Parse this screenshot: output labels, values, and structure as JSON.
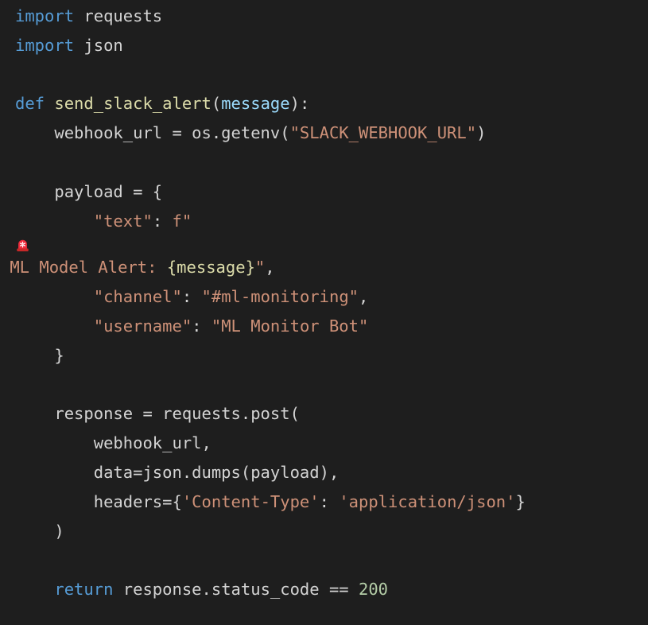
{
  "colors": {
    "background": "#1e1e1e",
    "keyword": "#569cd6",
    "function": "#dcdcaa",
    "parameter": "#9cdcfe",
    "string": "#ce9178",
    "number": "#b5cea8",
    "text": "#d4d4d4"
  },
  "code": {
    "l1": {
      "kw": "import",
      "rest": " requests"
    },
    "l2": {
      "kw": "import",
      "rest": " json"
    },
    "l4": {
      "kw": "def",
      "sp": " ",
      "fn": "send_slack_alert",
      "open": "(",
      "param": "message",
      "close": "):"
    },
    "l5": {
      "pre": "    webhook_url = os.getenv(",
      "str": "\"SLACK_WEBHOOK_URL\"",
      "post": ")"
    },
    "l7": {
      "text": "    payload = {"
    },
    "l8": {
      "indent": "        ",
      "key": "\"text\"",
      "colon": ": ",
      "fstr": "f\""
    },
    "l9_icon": "siren-emoji",
    "l10": {
      "str1": " ML Model Alert: ",
      "fmt": "{message}",
      "str2": "\"",
      "post": ","
    },
    "l11": {
      "indent": "        ",
      "key": "\"channel\"",
      "colon": ": ",
      "val": "\"#ml-monitoring\"",
      "post": ","
    },
    "l12": {
      "indent": "        ",
      "key": "\"username\"",
      "colon": ": ",
      "val": "\"ML Monitor Bot\""
    },
    "l13": {
      "text": "    }"
    },
    "l15": {
      "text": "    response = requests.post("
    },
    "l16": {
      "text": "        webhook_url,"
    },
    "l17": {
      "text": "        data=json.dumps(payload),"
    },
    "l18": {
      "pre": "        headers={",
      "key": "'Content-Type'",
      "colon": ": ",
      "val": "'application/json'",
      "post": "}"
    },
    "l19": {
      "text": "    )"
    },
    "l21": {
      "indent": "    ",
      "kw": "return",
      "mid": " response.status_code == ",
      "num": "200"
    }
  }
}
